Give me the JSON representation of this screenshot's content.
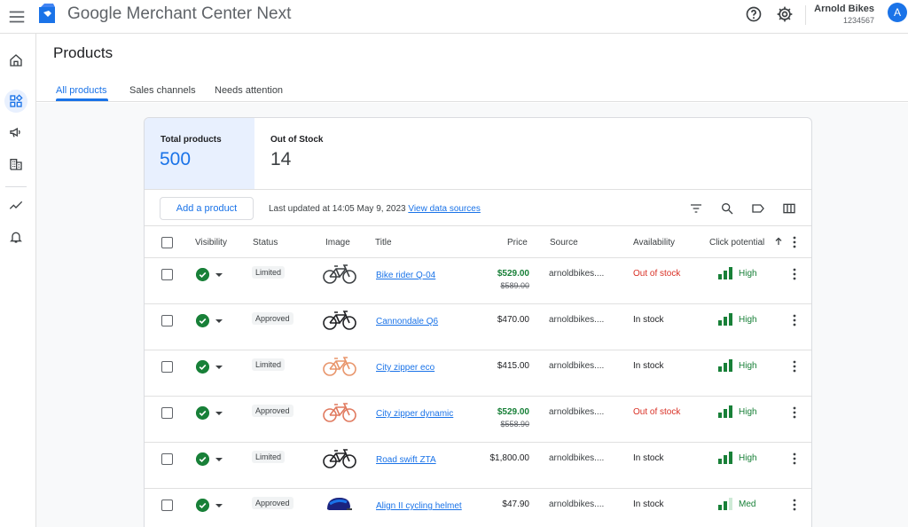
{
  "app": {
    "title": "Google Merchant Center Next",
    "account_name": "Arnold Bikes",
    "account_id": "1234567",
    "avatar_letter": "A"
  },
  "nav": {
    "rail_icons": [
      "home-icon",
      "products-icon",
      "marketing-icon",
      "business-icon",
      "performance-icon",
      "notifications-icon"
    ],
    "active": "products-icon"
  },
  "page": {
    "title": "Products",
    "tabs": [
      {
        "label": "All products",
        "active": true
      },
      {
        "label": "Sales channels",
        "active": false
      },
      {
        "label": "Needs attention",
        "active": false
      }
    ]
  },
  "stats": [
    {
      "label": "Total products",
      "value": "500"
    },
    {
      "label": "Out of Stock",
      "value": "14"
    }
  ],
  "toolbar": {
    "add_label": "Add a product",
    "updated_text": "Last updated at 14:05 May 9, 2023",
    "link_text": "View data sources",
    "icons": [
      "filter-icon",
      "search-icon",
      "label-icon",
      "columns-icon"
    ]
  },
  "table": {
    "headers": {
      "visibility": "Visibility",
      "status": "Status",
      "image": "Image",
      "title": "Title",
      "price": "Price",
      "source": "Source",
      "availability": "Availability",
      "click_potential": "Click potential"
    },
    "rows": [
      {
        "status": "Limited",
        "title": "Bike rider Q-04",
        "price": "$529.00",
        "old_price": "$589.00",
        "source": "arnoldbikes....",
        "availability": "Out of stock",
        "potential": "High",
        "level": 3,
        "bike_color": "#3c4043"
      },
      {
        "status": "Approved",
        "title": "Cannondale Q6",
        "price": "$470.00",
        "old_price": "",
        "source": "arnoldbikes....",
        "availability": "In stock",
        "potential": "High",
        "level": 3,
        "bike_color": "#202124"
      },
      {
        "status": "Limited",
        "title": "City zipper eco",
        "price": "$415.00",
        "old_price": "",
        "source": "arnoldbikes....",
        "availability": "In stock",
        "potential": "High",
        "level": 3,
        "bike_color": "#e8956b"
      },
      {
        "status": "Approved",
        "title": "City zipper dynamic",
        "price": "$529.00",
        "old_price": "$558.90",
        "source": "arnoldbikes....",
        "availability": "Out of stock",
        "potential": "High",
        "level": 3,
        "bike_color": "#e07a5f"
      },
      {
        "status": "Limited",
        "title": "Road swift ZTA",
        "price": "$1,800.00",
        "old_price": "",
        "source": "arnoldbikes....",
        "availability": "In stock",
        "potential": "High",
        "level": 3,
        "bike_color": "#202124"
      },
      {
        "status": "Approved",
        "title": "Align II cycling helmet",
        "price": "$47.90",
        "old_price": "",
        "source": "arnoldbikes....",
        "availability": "In stock",
        "potential": "Med",
        "level": 2,
        "bike_color": "#1a73e8"
      }
    ]
  },
  "colors": {
    "accent": "#1a73e8",
    "success": "#188038",
    "error": "#d93025"
  }
}
